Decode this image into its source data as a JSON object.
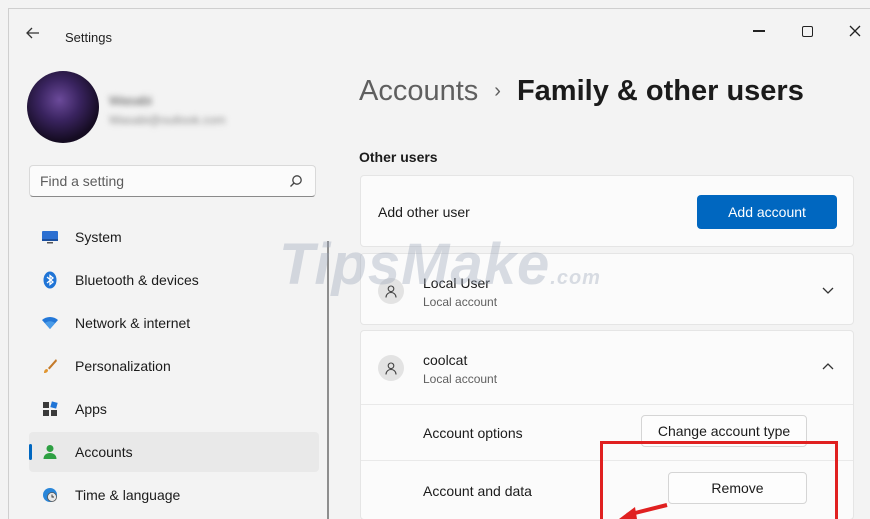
{
  "window": {
    "app_title": "Settings",
    "controls": [
      "minimize",
      "maximize",
      "close"
    ]
  },
  "profile": {
    "name": "Wasabi",
    "email": "Wasabi@outlook.com"
  },
  "search": {
    "placeholder": "Find a setting"
  },
  "nav": {
    "items": [
      {
        "label": "System",
        "icon": "monitor-icon"
      },
      {
        "label": "Bluetooth & devices",
        "icon": "bluetooth-icon"
      },
      {
        "label": "Network & internet",
        "icon": "wifi-icon"
      },
      {
        "label": "Personalization",
        "icon": "brush-icon"
      },
      {
        "label": "Apps",
        "icon": "apps-icon"
      },
      {
        "label": "Accounts",
        "icon": "person-icon",
        "selected": true
      },
      {
        "label": "Time & language",
        "icon": "globe-clock-icon"
      }
    ]
  },
  "breadcrumb": {
    "parent": "Accounts",
    "separator": "›",
    "current": "Family & other users"
  },
  "other_users": {
    "section_title": "Other users",
    "add_label": "Add other user",
    "add_button": "Add account",
    "users": [
      {
        "name": "Local User",
        "type": "Local account",
        "expanded": false
      },
      {
        "name": "coolcat",
        "type": "Local account",
        "expanded": true,
        "options_label": "Account options",
        "options_button": "Change account type",
        "data_label": "Account and data",
        "data_button": "Remove"
      }
    ]
  },
  "watermark": {
    "brand": "TipsMake",
    "suffix": ".com"
  },
  "colors": {
    "accent": "#0067c0",
    "highlight": "#e02020"
  }
}
